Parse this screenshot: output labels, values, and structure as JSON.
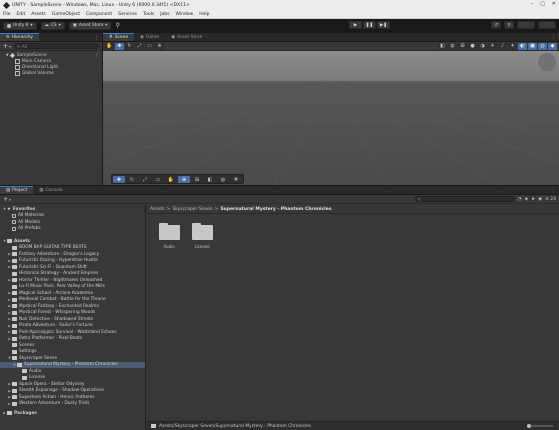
{
  "window": {
    "title": "UNITY - SampleScene - Windows, Mac, Linux - Unity 6 (6000.0.34f1) <DX11>",
    "controls": [
      "–",
      "▢",
      "✕"
    ]
  },
  "menu": [
    "File",
    "Edit",
    "Assets",
    "GameObject",
    "Component",
    "Services",
    "Tools",
    "Jobs",
    "Window",
    "Help"
  ],
  "toolbar": {
    "account": "Unity 6",
    "cloud": "CS",
    "asset_store": "Asset Store",
    "play": "▶",
    "pause": "❚❚",
    "step": "▶❚"
  },
  "hierarchy": {
    "tab": "Hierarchy",
    "search_placeholder": "All",
    "scene": "SampleScene",
    "objects": [
      "Main Camera",
      "Directional Light",
      "Global Volume"
    ]
  },
  "scene_tabs": [
    "Scene",
    "Game",
    "Asset Store"
  ],
  "project": {
    "tabs": [
      "Project",
      "Console"
    ],
    "favorites_label": "Favorites",
    "favorites": [
      "All Materials",
      "All Models",
      "All Prefabs"
    ],
    "assets_label": "Assets",
    "asset_folders": [
      "BOOM BAP GUITAR TYPE BEATS",
      "Fantasy Adventure - Dragon's Legacy",
      "Futuristic Racing - Hyperdrive Hustle",
      "Futuristic Sci-Fi - Quantum Shift",
      "Historical Strategy - Ancient Empires",
      "Horror Thriller - Nightmares Unleashed",
      "Lo-Fi Music Pack: Park Valley of the Mills",
      "Magical School - Arcane Academia",
      "Medieval Combat - Battle for the Throne",
      "Mystical Fantasy - Enchanted Realms",
      "Mystical Forest - Whispering Woods",
      "Noir Detective - Shadowed Streets",
      "Pirate Adventure - Sailor's Fortune",
      "Post-Apocalyptic Survival - Wasteland Echoes",
      "Retro Platformer - Pixel Beats",
      "Scenes",
      "Settings",
      "Skyscraper Seven"
    ],
    "selected_folder": "Supernatural Mystery - Phantom Chronicles",
    "selected_children": [
      "Audio",
      "License"
    ],
    "after_folders": [
      "Space Opera - Stellar Odyssey",
      "Stealth Espionage - Shadow Operatives",
      "Superhero Action - Heroic Anthems",
      "Western Adventure - Dusty Trails"
    ],
    "packages_label": "Packages",
    "breadcrumb": [
      "Assets",
      "Skyscraper Seven",
      "Supernatural Mystery - Phantom Chronicles"
    ],
    "breadcrumb_sep": ">",
    "folder_items": [
      "Audio",
      "License"
    ],
    "status_path": "Assets/Skyscraper Seven/Supernatural Mystery - Phantom Chronicles",
    "count_badge": "24"
  }
}
